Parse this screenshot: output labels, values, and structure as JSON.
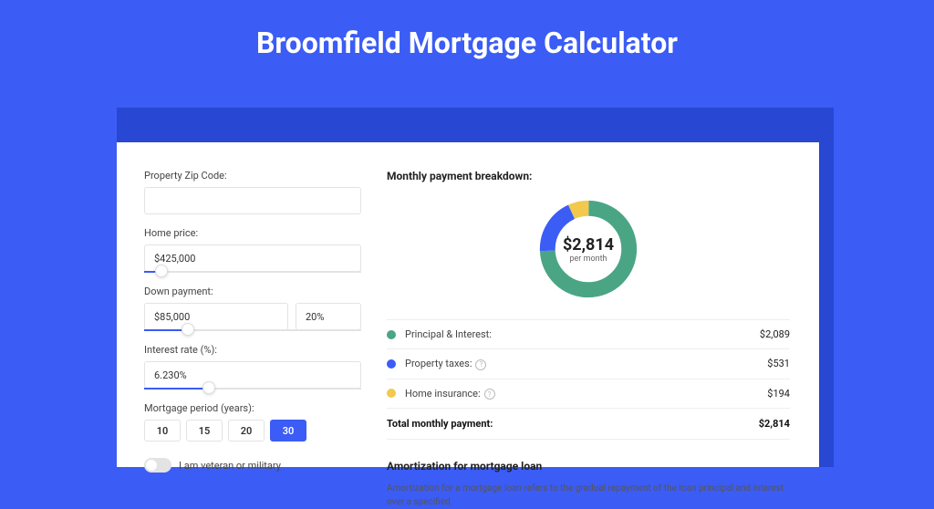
{
  "page": {
    "title": "Broomfield Mortgage Calculator"
  },
  "form": {
    "zip_label": "Property Zip Code:",
    "zip_value": "",
    "home_price_label": "Home price:",
    "home_price_value": "$425,000",
    "home_price_slider_pct": 8,
    "down_payment_label": "Down payment:",
    "down_payment_value": "$85,000",
    "down_payment_pct": "20%",
    "down_payment_slider_pct": 20,
    "interest_label": "Interest rate (%):",
    "interest_value": "6.230%",
    "interest_slider_pct": 30,
    "period_label": "Mortgage period (years):",
    "periods": [
      "10",
      "15",
      "20",
      "30"
    ],
    "period_active": "30",
    "veteran_label": "I am veteran or military"
  },
  "breakdown": {
    "title": "Monthly payment breakdown:",
    "center_value": "$2,814",
    "center_sub": "per month",
    "items": [
      {
        "label": "Principal & Interest:",
        "value": "$2,089",
        "color": "#4aa585",
        "info": false
      },
      {
        "label": "Property taxes:",
        "value": "$531",
        "color": "#3b5cf5",
        "info": true
      },
      {
        "label": "Home insurance:",
        "value": "$194",
        "color": "#f2c94c",
        "info": true
      }
    ],
    "total_label": "Total monthly payment:",
    "total_value": "$2,814"
  },
  "amortization": {
    "title": "Amortization for mortgage loan",
    "text": "Amortization for a mortgage loan refers to the gradual repayment of the loan principal and interest over a specified"
  },
  "chart_data": {
    "type": "pie",
    "title": "Monthly payment breakdown",
    "categories": [
      "Principal & Interest",
      "Property taxes",
      "Home insurance"
    ],
    "values": [
      2089,
      531,
      194
    ],
    "colors": [
      "#4aa585",
      "#3b5cf5",
      "#f2c94c"
    ],
    "total": 2814
  }
}
